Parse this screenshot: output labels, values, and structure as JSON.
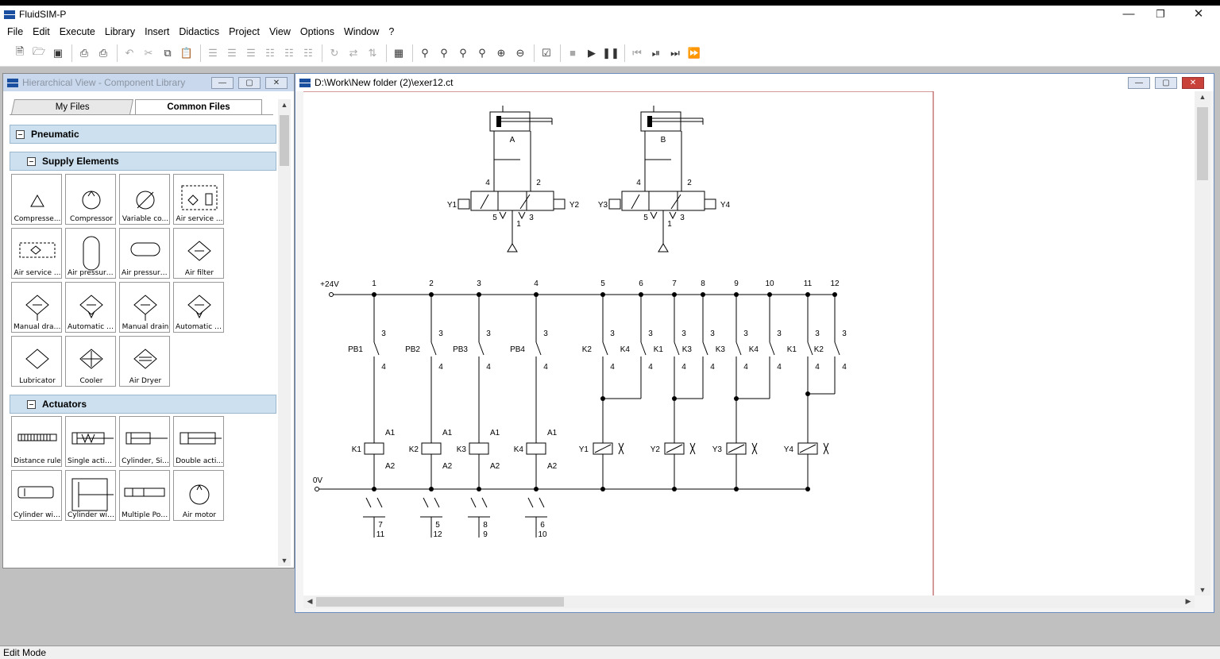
{
  "app": {
    "title": "FluidSIM-P",
    "logo": "festo-logo",
    "window_controls": [
      "minimize",
      "restore",
      "close"
    ]
  },
  "menu": [
    "File",
    "Edit",
    "Execute",
    "Library",
    "Insert",
    "Didactics",
    "Project",
    "View",
    "Options",
    "Window",
    "?"
  ],
  "toolbar": [
    "new",
    "open",
    "save",
    "print-preview",
    "print",
    "undo",
    "cut",
    "copy",
    "paste",
    "align-left",
    "align-center",
    "align-right",
    "align-top",
    "align-middle",
    "align-bottom",
    "rotate",
    "flip-h",
    "flip-v",
    "grid",
    "zoom-window",
    "zoom-all",
    "zoom-fit",
    "zoom-selection",
    "zoom-in",
    "zoom-out",
    "check",
    "stop",
    "play",
    "pause",
    "rewind",
    "step-back",
    "step-forward",
    "fast-forward"
  ],
  "library": {
    "title": "Hierarchical View - Component Library",
    "tabs": [
      "My Files",
      "Common Files"
    ],
    "groups": {
      "pneumatic": "Pneumatic",
      "supply": "Supply Elements",
      "actuators": "Actuators"
    },
    "supply_items": [
      "Compresse...",
      "Compressor",
      "Variable co...",
      "Air service ...",
      "Air service ...",
      "Air pressure...",
      "Air pressure...",
      "Air filter",
      "Manual drai...",
      "Automatic d...",
      "Manual drain",
      "Automatic d...",
      "Lubricator",
      "Cooler",
      "Air Dryer"
    ],
    "actuator_items": [
      "Distance rule",
      "Single actin...",
      "Cylinder, Si...",
      "Double acti...",
      "Cylinder wit...",
      "Cylinder wit...",
      "Multiple Pos...",
      "Air motor",
      "",
      "",
      "",
      ""
    ]
  },
  "document": {
    "title": "D:\\Work\\New folder (2)\\exer12.ct"
  },
  "circuit": {
    "cylinders": [
      "A",
      "B"
    ],
    "valve1": {
      "left": "Y1",
      "right": "Y2",
      "ports": [
        "4",
        "2",
        "5",
        "3",
        "1"
      ]
    },
    "valve2": {
      "left": "Y3",
      "right": "Y4",
      "ports": [
        "4",
        "2",
        "5",
        "3",
        "1"
      ]
    },
    "supply_label": "+24V",
    "ground_label": "0V",
    "rungs": [
      "1",
      "2",
      "3",
      "4",
      "5",
      "6",
      "7",
      "8",
      "9",
      "10",
      "11",
      "12"
    ],
    "contacts": [
      "PB1",
      "PB2",
      "PB3",
      "PB4",
      "K2",
      "K4",
      "K1",
      "K3",
      "K3",
      "K4",
      "K1",
      "K2"
    ],
    "contact_top_pin": "3",
    "contact_bottom_pin": "4",
    "relays": [
      "K1",
      "K2",
      "K3",
      "K4"
    ],
    "relay_pins": [
      "A1",
      "A2"
    ],
    "solenoids": [
      "Y1",
      "Y2",
      "Y3",
      "Y4"
    ],
    "contact_tables": [
      {
        "top": "7",
        "bottom": "11"
      },
      {
        "top": "5",
        "bottom": "12"
      },
      {
        "top": "8",
        "bottom": "9"
      },
      {
        "top": "6",
        "bottom": "10"
      }
    ]
  },
  "status": {
    "mode": "Edit Mode"
  }
}
